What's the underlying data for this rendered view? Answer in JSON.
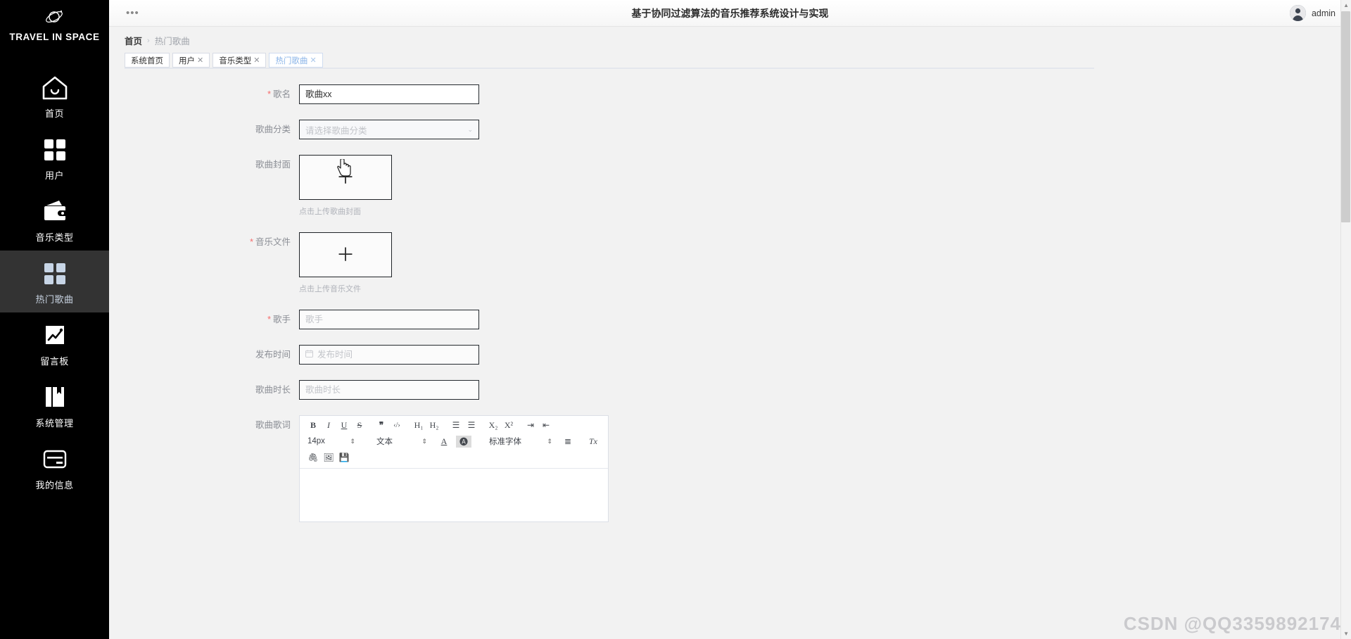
{
  "sidebar": {
    "brand": "TRAVEL IN SPACE",
    "brand_icon": "planet-icon",
    "items": [
      {
        "label": "首页",
        "icon": "home-icon",
        "active": false
      },
      {
        "label": "用户",
        "icon": "grid-icon",
        "active": false
      },
      {
        "label": "音乐类型",
        "icon": "wallet-icon",
        "active": false
      },
      {
        "label": "热门歌曲",
        "icon": "grid-icon",
        "active": true
      },
      {
        "label": "留言板",
        "icon": "chart-icon",
        "active": false
      },
      {
        "label": "系统管理",
        "icon": "book-icon",
        "active": false
      },
      {
        "label": "我的信息",
        "icon": "card-icon",
        "active": false
      }
    ]
  },
  "topbar": {
    "menu_icon": "•••",
    "title": "基于协同过滤算法的音乐推荐系统设计与实现",
    "avatar_icon": "user-avatar",
    "username": "admin"
  },
  "breadcrumb": {
    "home": "首页",
    "separator": "›",
    "current": "热门歌曲"
  },
  "tabs": [
    {
      "label": "系统首页",
      "closable": false,
      "active": false
    },
    {
      "label": "用户",
      "closable": true,
      "active": false
    },
    {
      "label": "音乐类型",
      "closable": true,
      "active": false
    },
    {
      "label": "热门歌曲",
      "closable": true,
      "active": true
    }
  ],
  "tab_close_glyph": "✕",
  "form": {
    "song_name": {
      "label": "歌名",
      "required": true,
      "value": "歌曲xx",
      "placeholder": "歌名"
    },
    "category": {
      "label": "歌曲分类",
      "required": false,
      "value": "",
      "placeholder": "请选择歌曲分类",
      "caret": "⌄"
    },
    "cover": {
      "label": "歌曲封面",
      "required": false,
      "plus": "＋",
      "tip": "点击上传歌曲封面"
    },
    "music_file": {
      "label": "音乐文件",
      "required": true,
      "plus": "＋",
      "tip": "点击上传音乐文件"
    },
    "singer": {
      "label": "歌手",
      "required": true,
      "value": "",
      "placeholder": "歌手"
    },
    "publish_time": {
      "label": "发布时间",
      "required": false,
      "value": "",
      "placeholder": "发布时间",
      "icon": "calendar-icon"
    },
    "duration": {
      "label": "歌曲时长",
      "required": false,
      "value": "",
      "placeholder": "歌曲时长"
    },
    "lyrics": {
      "label": "歌曲歌词"
    }
  },
  "editor": {
    "row1": [
      {
        "name": "bold-icon",
        "glyph": "B"
      },
      {
        "name": "italic-icon",
        "glyph": "I"
      },
      {
        "name": "underline-icon",
        "glyph": "U"
      },
      {
        "name": "strikethrough-icon",
        "glyph": "S"
      },
      {
        "name": "quote-icon",
        "glyph": "❞"
      },
      {
        "name": "code-icon",
        "glyph": "‹/›"
      },
      {
        "name": "heading-1-icon",
        "glyph": "H₁"
      },
      {
        "name": "heading-2-icon",
        "glyph": "H₂"
      },
      {
        "name": "ordered-list-icon",
        "glyph": "☰"
      },
      {
        "name": "unordered-list-icon",
        "glyph": "☰"
      },
      {
        "name": "subscript-icon",
        "glyph": "X₂"
      },
      {
        "name": "superscript-icon",
        "glyph": "X²"
      },
      {
        "name": "indent-icon",
        "glyph": "⇥"
      },
      {
        "name": "outdent-icon",
        "glyph": "⇤"
      }
    ],
    "font_size": {
      "value": "14px",
      "arrows": "⇕"
    },
    "block_type": {
      "value": "文本",
      "arrows": "⇕"
    },
    "text_color": {
      "name": "text-color-icon",
      "glyph": "A"
    },
    "bg_color": {
      "name": "background-color-icon",
      "glyph": "🅐"
    },
    "font_family": {
      "value": "标准字体",
      "arrows": "⇕"
    },
    "align": {
      "name": "align-left-icon",
      "glyph": "≣"
    },
    "clear_format": {
      "name": "clear-format-icon",
      "glyph": "Tx"
    },
    "row3": [
      {
        "name": "attachment-icon",
        "glyph": "🖇"
      },
      {
        "name": "image-icon",
        "glyph": "🖼"
      },
      {
        "name": "save-icon",
        "glyph": "💾"
      }
    ]
  },
  "watermark": "CSDN @QQ3359892174",
  "colors": {
    "sidebar_bg": "#000000",
    "sidebar_active": "#333333",
    "accent": "#8ab4e8",
    "required": "#f56c6c",
    "page_bg": "#f2f2f2"
  }
}
